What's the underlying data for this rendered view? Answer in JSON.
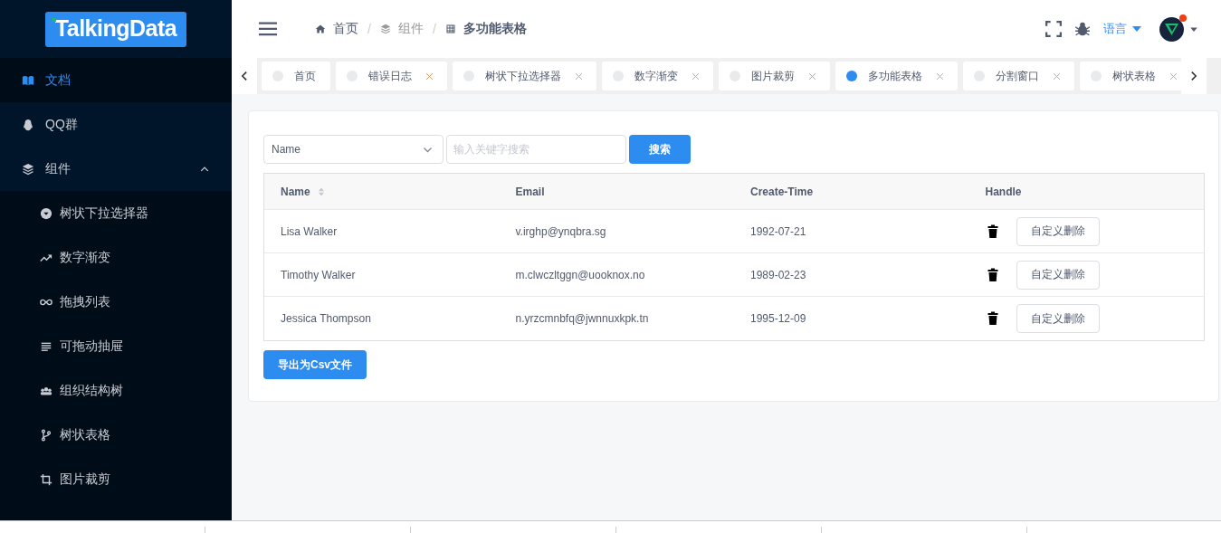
{
  "logo": {
    "text": "TalkingData"
  },
  "sidebar": {
    "items": [
      {
        "label": "文档",
        "selected": true
      },
      {
        "label": "QQ群",
        "selected": false
      },
      {
        "label": "组件",
        "selected": false,
        "expanded": true,
        "children": [
          {
            "label": "树状下拉选择器",
            "selected": false
          },
          {
            "label": "数字渐变",
            "selected": false
          },
          {
            "label": "拖拽列表",
            "selected": false
          },
          {
            "label": "可拖动抽屉",
            "selected": false
          },
          {
            "label": "组织结构树",
            "selected": false
          },
          {
            "label": "树状表格",
            "selected": false
          },
          {
            "label": "图片裁剪",
            "selected": false
          }
        ]
      }
    ]
  },
  "breadcrumb": [
    {
      "label": "首页",
      "current": false
    },
    {
      "label": "组件",
      "current": false,
      "separator": "/"
    },
    {
      "label": "多功能表格",
      "current": true,
      "separator": "/"
    }
  ],
  "header": {
    "language": "语言",
    "notification": true
  },
  "tabs": [
    {
      "label": "首页",
      "selected": false,
      "closable": false
    },
    {
      "label": "错误日志",
      "selected": false,
      "closable": true
    },
    {
      "label": "树状下拉选择器",
      "selected": false,
      "closable": true
    },
    {
      "label": "数字渐变",
      "selected": false,
      "closable": true
    },
    {
      "label": "图片裁剪",
      "selected": false,
      "closable": true
    },
    {
      "label": "多功能表格",
      "selected": true,
      "closable": true
    },
    {
      "label": "分割窗口",
      "selected": false,
      "closable": true
    },
    {
      "label": "树状表格",
      "selected": false,
      "closable": true
    }
  ],
  "filter": {
    "field": "Name",
    "placeholder": "输入关键字搜索",
    "button": "搜索"
  },
  "table": {
    "columns": [
      {
        "label": "Name",
        "sortable": true
      },
      {
        "label": "Email",
        "sortable": false
      },
      {
        "label": "Create-Time",
        "sortable": false
      },
      {
        "label": "Handle",
        "sortable": false
      }
    ],
    "rows": [
      {
        "name": "Lisa Walker",
        "email": "v.irghp@ynqbra.sg",
        "time": "1992-07-21",
        "action": "自定义删除"
      },
      {
        "name": "Timothy Walker",
        "email": "m.clwczltggn@uooknox.no",
        "time": "1989-02-23",
        "action": "自定义删除"
      },
      {
        "name": "Jessica Thompson",
        "email": "n.yrzcmnbfq@jwnnuxkpk.tn",
        "time": "1995-12-09",
        "action": "自定义删除"
      }
    ]
  },
  "export_button": "导出为Csv文件"
}
